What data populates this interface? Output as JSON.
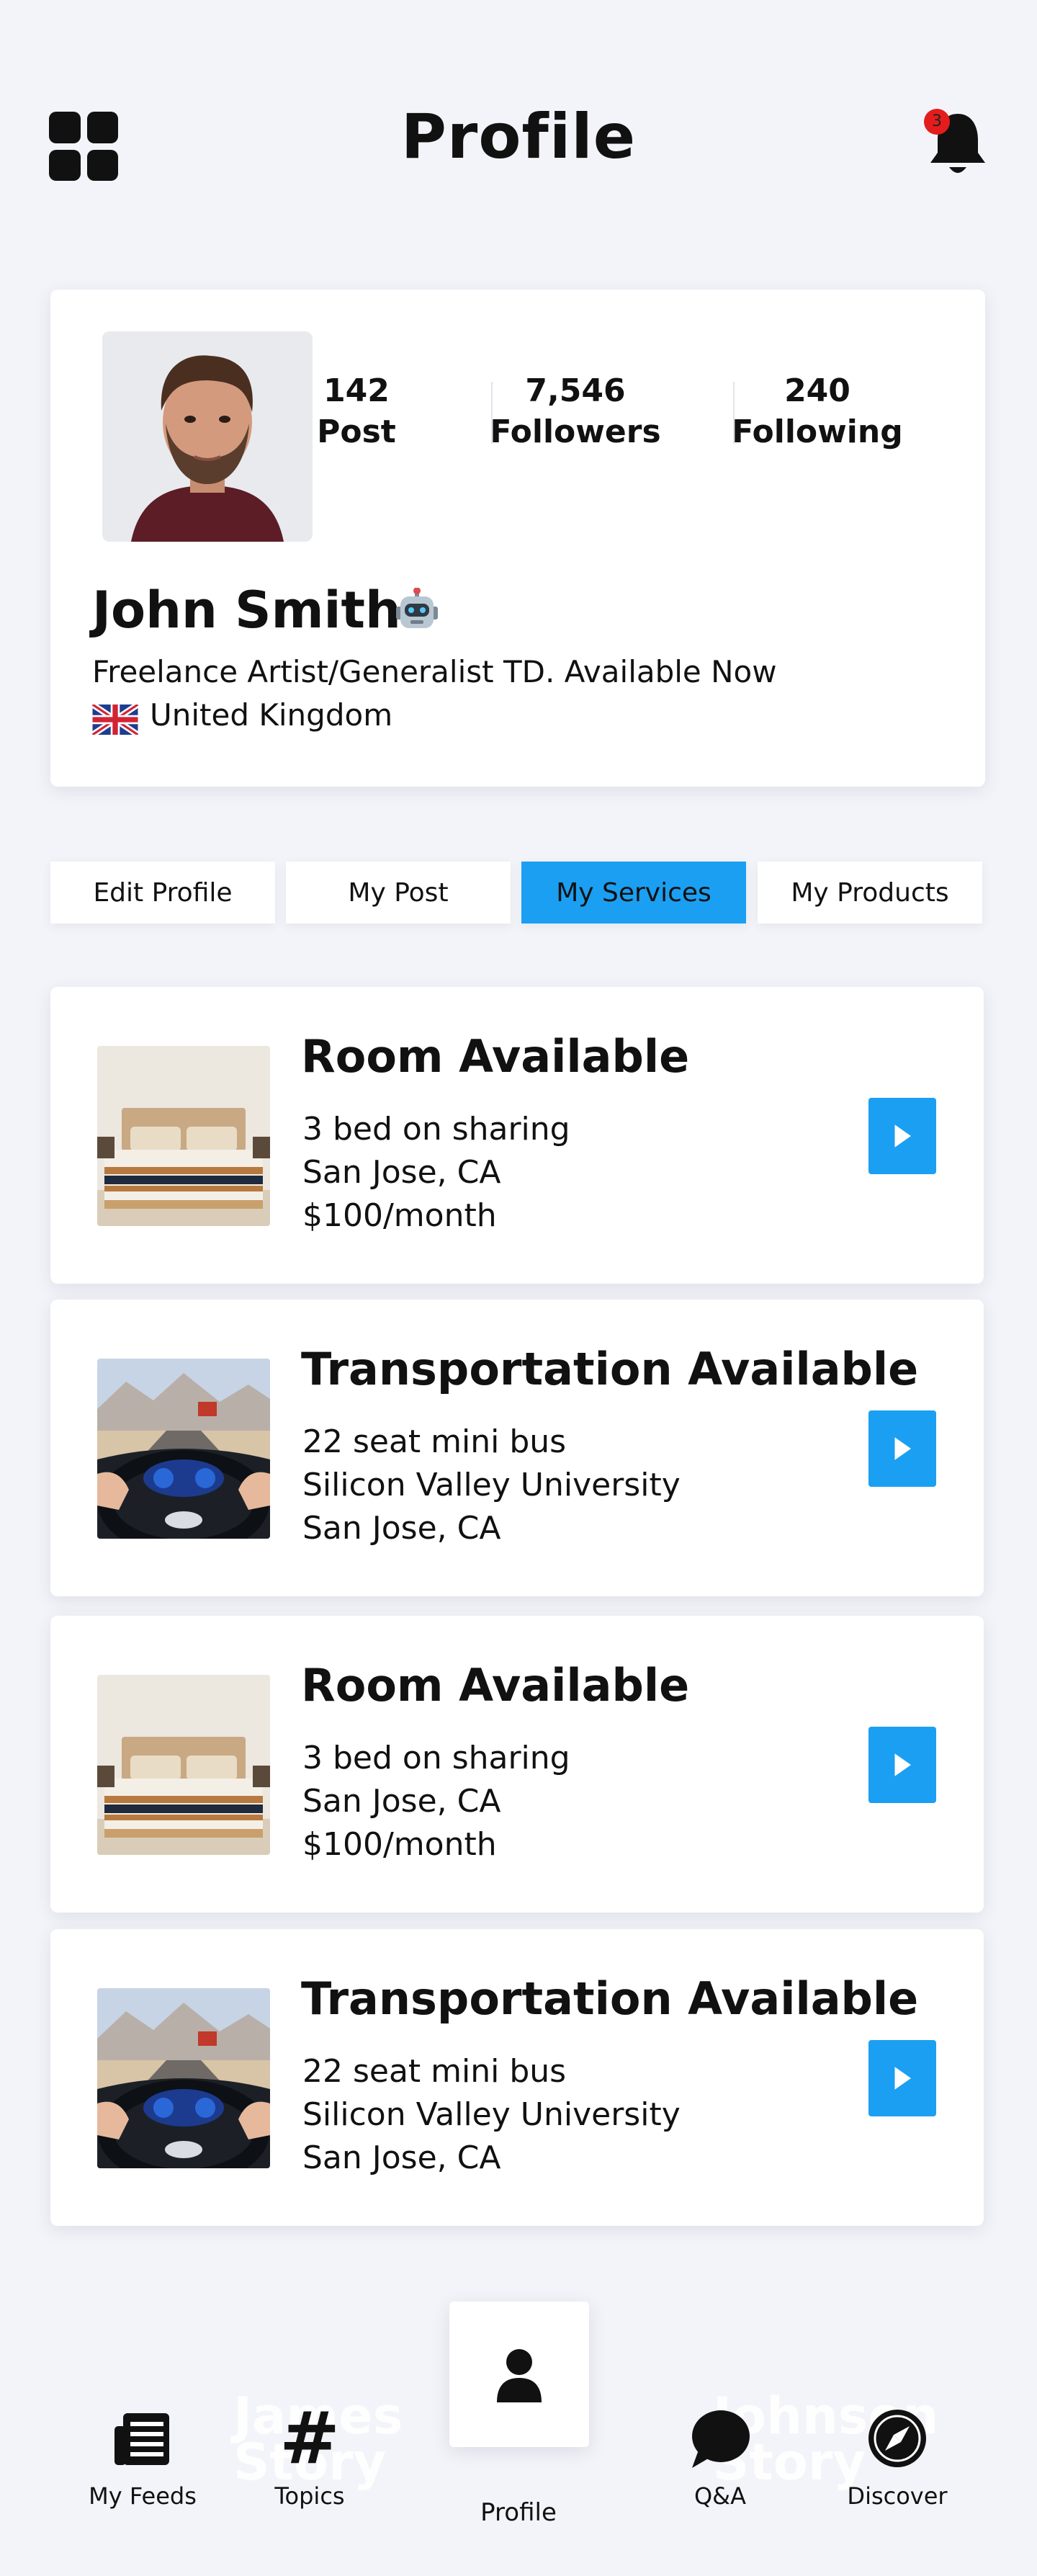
{
  "header": {
    "title": "Profile",
    "notification_count": "3"
  },
  "profile": {
    "stats": [
      {
        "value": "142",
        "label": "Post"
      },
      {
        "value": "7,546",
        "label": "Followers"
      },
      {
        "value": "240",
        "label": "Following"
      }
    ],
    "name": "John Smith",
    "bio": "Freelance Artist/Generalist TD. Available Now",
    "country": "United Kingdom"
  },
  "tabs": [
    {
      "label": "Edit Profile",
      "active": false
    },
    {
      "label": "My Post",
      "active": false
    },
    {
      "label": "My Services",
      "active": true
    },
    {
      "label": "My Products",
      "active": false
    }
  ],
  "services": [
    {
      "title": "Room Available",
      "lines": [
        "3 bed on sharing",
        "San Jose, CA",
        "$100/month"
      ],
      "image": "bedroom"
    },
    {
      "title": "Transportation Available",
      "lines": [
        "22 seat mini bus",
        "Silicon Valley University",
        "San Jose, CA"
      ],
      "image": "steering-wheel"
    },
    {
      "title": "Room Available",
      "lines": [
        "3 bed on sharing",
        "San Jose, CA",
        "$100/month"
      ],
      "image": "bedroom"
    },
    {
      "title": "Transportation Available",
      "lines": [
        "22 seat mini bus",
        "Silicon Valley University",
        "San Jose, CA"
      ],
      "image": "steering-wheel"
    }
  ],
  "nav": {
    "items": [
      {
        "label": "My Feeds",
        "icon": "newspaper-icon"
      },
      {
        "label": "Topics",
        "icon": "hashtag-icon"
      },
      {
        "label": "Profile",
        "icon": "user-icon"
      },
      {
        "label": "Q&A",
        "icon": "chat-bubble-icon"
      },
      {
        "label": "Discover",
        "icon": "compass-icon"
      }
    ],
    "ghost_text_left": [
      "James",
      "Story"
    ],
    "ghost_text_right": [
      "Johnson",
      "Story"
    ]
  },
  "colors": {
    "accent": "#1b9ff2",
    "badge": "#e51c1c",
    "background": "#f3f4f9"
  }
}
